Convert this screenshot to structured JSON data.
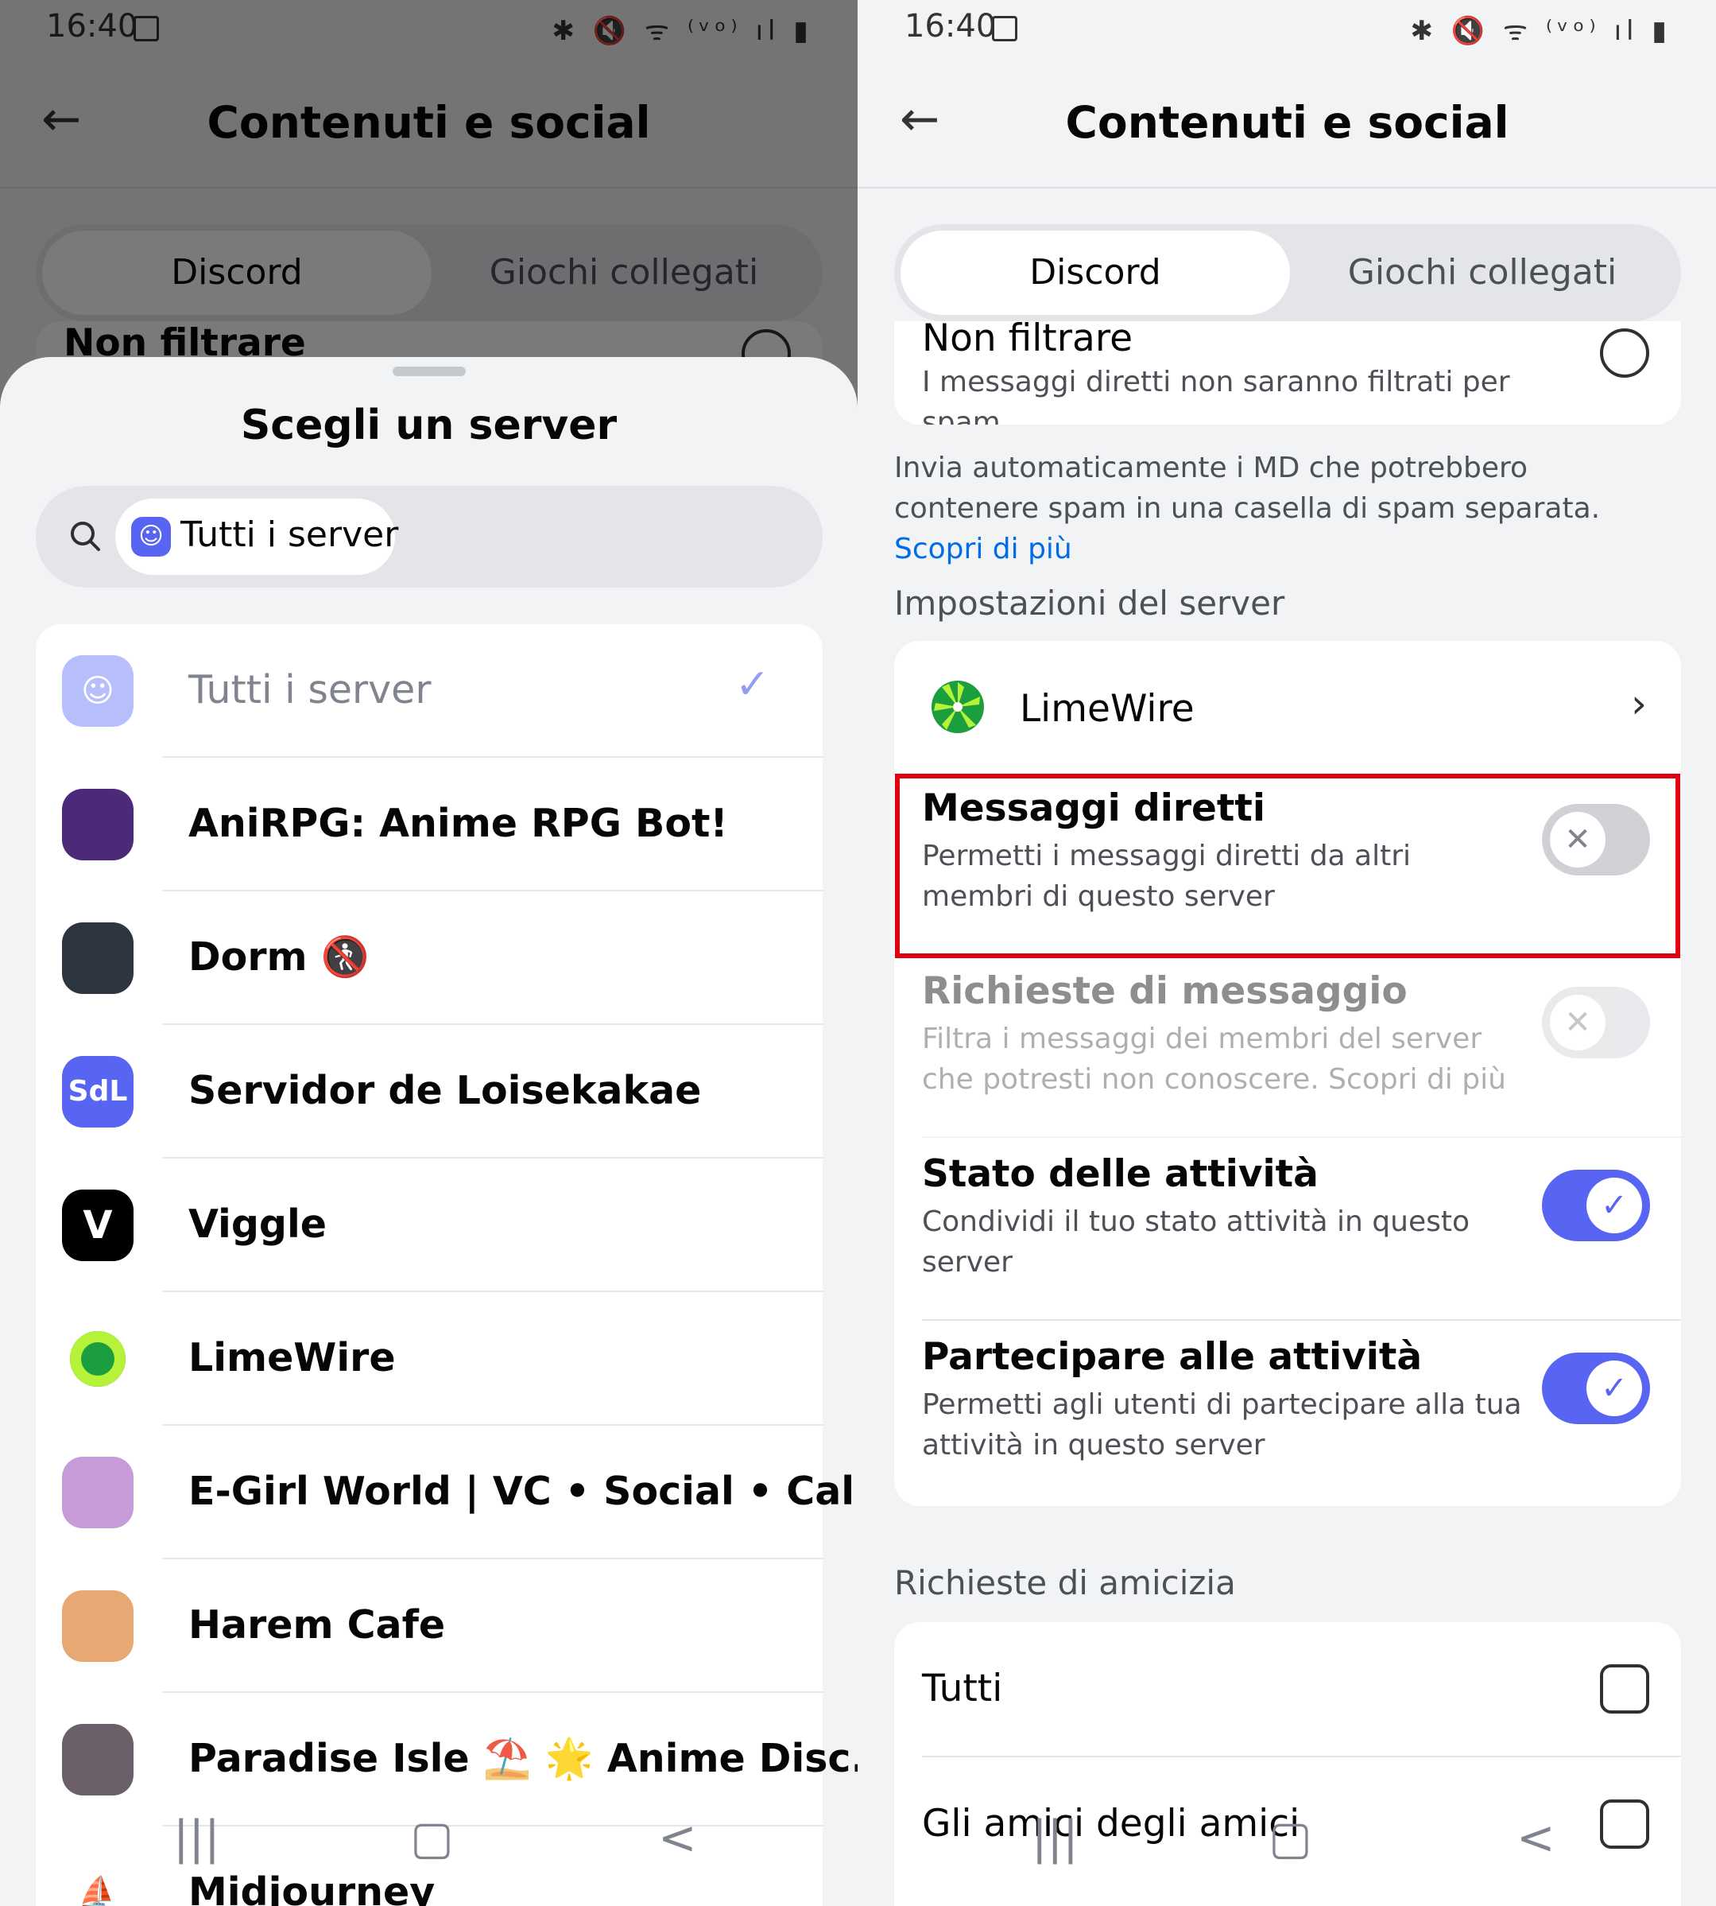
{
  "status_bar": {
    "time": "16:40",
    "icons": "✱ 🔇 ᯤ ⁽ᵛᵒ⁾ ıl ▮"
  },
  "app_bar": {
    "back_icon": "arrow-left",
    "title": "Contenuti e social"
  },
  "tabs": {
    "active": "Discord",
    "other": "Giochi collegati"
  },
  "spam_filter": {
    "option_title": "Non filtrare",
    "option_desc": "I messaggi diretti non saranno filtrati per spam",
    "note": "Invia automaticamente i MD che potrebbero contenere spam in una casella di spam separata.",
    "link": "Scopri di più"
  },
  "server_settings": {
    "header": "Impostazioni del server",
    "server_name": "LimeWire",
    "rows": [
      {
        "title": "Messaggi diretti",
        "desc": "Permetti i messaggi diretti da altri membri di questo server",
        "state": "off",
        "disabled": false
      },
      {
        "title": "Richieste di messaggio",
        "desc": "Filtra i messaggi dei membri del server che potresti non conoscere. Scopri di più",
        "state": "off",
        "disabled": true
      },
      {
        "title": "Stato delle attività",
        "desc": "Condividi il tuo stato attività in questo server",
        "state": "on",
        "disabled": false
      },
      {
        "title": "Partecipare alle attività",
        "desc": "Permetti agli utenti di partecipare alla tua attività in questo server",
        "state": "on",
        "disabled": false
      }
    ]
  },
  "friend_requests": {
    "header": "Richieste di amicizia",
    "options": [
      "Tutti",
      "Gli amici degli amici"
    ]
  },
  "sheet": {
    "title": "Scegli un server",
    "search_chip": "Tutti i server",
    "servers": [
      {
        "name": "Tutti i server",
        "selected": true,
        "color": "#aab3fb",
        "icon": "discord-icon"
      },
      {
        "name": "AniRPG: Anime RPG Bot!",
        "color": "#4b2a7a",
        "icon": "anime-avatar-icon"
      },
      {
        "name": "Dorm 🚷",
        "color": "#2c3540",
        "icon": "dorm-icon"
      },
      {
        "name": "Servidor de Loisekakae",
        "color": "#5865f2",
        "icon": "SdL"
      },
      {
        "name": "Viggle",
        "color": "#000000",
        "icon": "viggle-icon"
      },
      {
        "name": "LimeWire",
        "color": "#ffffff",
        "icon": "limewire-icon"
      },
      {
        "name": "E-Girl World | VC • Social • Call...",
        "color": "#c79ad8",
        "icon": "egirl-icon"
      },
      {
        "name": "Harem Cafe",
        "color": "#e7a873",
        "icon": "harem-icon"
      },
      {
        "name": "Paradise Isle ⛱️ 🌟 Anime Disc...",
        "color": "#6b5f6a",
        "icon": "paradise-icon"
      },
      {
        "name": "Midjourney",
        "color": "#ffffff",
        "icon": "sailboat-icon"
      }
    ]
  },
  "nav": {
    "recents": "|||",
    "home": "▢",
    "back": "<"
  }
}
